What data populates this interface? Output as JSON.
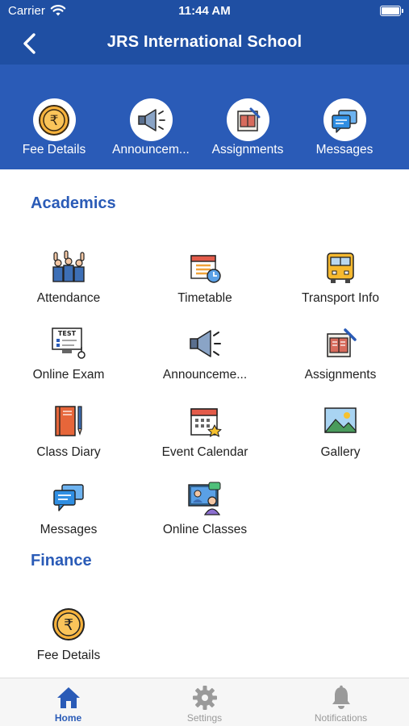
{
  "status_bar": {
    "carrier": "Carrier",
    "time": "11:44 AM",
    "wifi_icon": "wifi-icon",
    "battery_icon": "battery-icon"
  },
  "nav": {
    "title": "JRS International School",
    "back_icon": "chevron-left-icon"
  },
  "quick_access": [
    {
      "label": "Fee Details",
      "icon": "rupee-coin-icon"
    },
    {
      "label": "Announcem...",
      "icon": "megaphone-icon"
    },
    {
      "label": "Assignments",
      "icon": "assignment-icon"
    },
    {
      "label": "Messages",
      "icon": "chat-bubbles-icon"
    }
  ],
  "sections": {
    "academics": {
      "title": "Academics",
      "items": [
        {
          "label": "Attendance",
          "icon": "raised-hands-icon"
        },
        {
          "label": "Timetable",
          "icon": "calendar-clock-icon"
        },
        {
          "label": "Transport Info",
          "icon": "school-bus-icon"
        },
        {
          "label": "Online Exam",
          "icon": "computer-test-icon"
        },
        {
          "label": "Announceme...",
          "icon": "megaphone-icon"
        },
        {
          "label": "Assignments",
          "icon": "assignment-icon"
        },
        {
          "label": "Class Diary",
          "icon": "notebook-pen-icon"
        },
        {
          "label": "Event Calendar",
          "icon": "calendar-star-icon"
        },
        {
          "label": "Gallery",
          "icon": "landscape-picture-icon"
        },
        {
          "label": "Messages",
          "icon": "chat-bubbles-icon"
        },
        {
          "label": "Online Classes",
          "icon": "video-class-icon"
        }
      ]
    },
    "finance": {
      "title": "Finance",
      "items": [
        {
          "label": "Fee Details",
          "icon": "rupee-coin-icon"
        }
      ]
    }
  },
  "tab_bar": {
    "tabs": [
      {
        "label": "Home",
        "icon": "home-icon",
        "active": true
      },
      {
        "label": "Settings",
        "icon": "gear-icon",
        "active": false
      },
      {
        "label": "Notifications",
        "icon": "bell-icon",
        "active": false
      }
    ]
  },
  "colors": {
    "primary": "#1f4fa3",
    "banner": "#2a5bb7",
    "accent_text": "#2a5bb7"
  },
  "wifi_icon": "wifi-icon",
  "battery_icon": "battery-icon"
}
